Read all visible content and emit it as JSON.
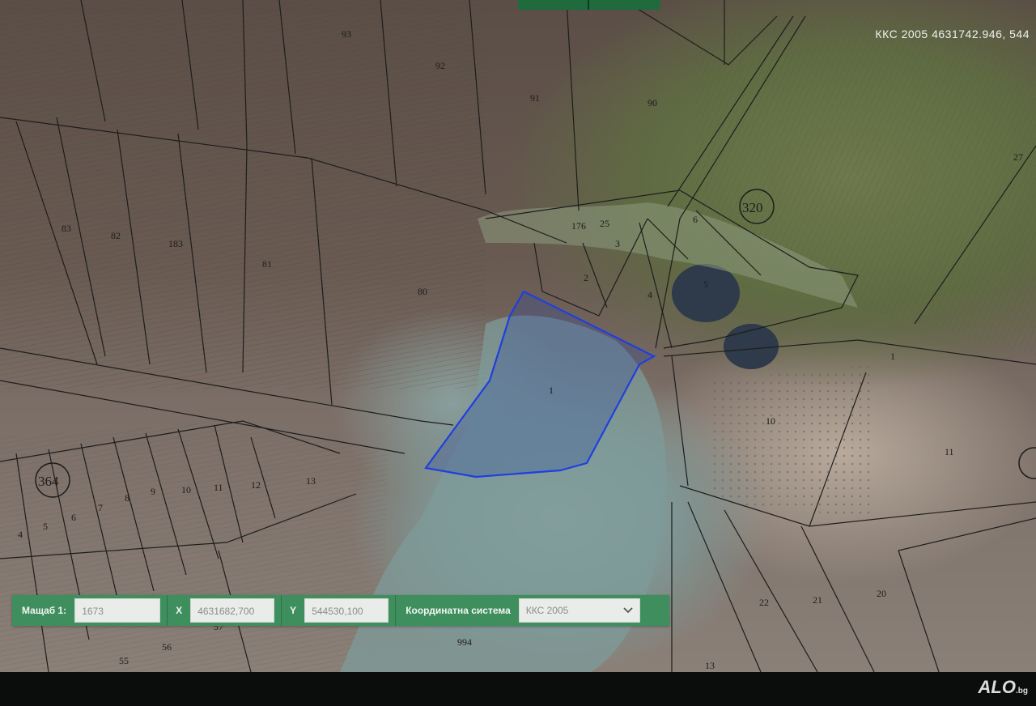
{
  "coordinate_readout": "ККС 2005 4631742.946, 544",
  "parcels": {
    "n93": "93",
    "n92": "92",
    "n91": "91",
    "n90": "90",
    "n83": "83",
    "n82": "82",
    "n183": "183",
    "n81": "81",
    "n80": "80",
    "n176": "176",
    "n25": "25",
    "n3": "3",
    "n6": "6",
    "n2": "2",
    "n4": "4",
    "n5": "5",
    "n1_lake": "1",
    "n1_right": "1",
    "n10": "10",
    "n11": "11",
    "n27": "27",
    "block_320": "320",
    "block_364": "364",
    "s4": "4",
    "s5": "5",
    "s6": "6",
    "s7": "7",
    "s8": "8",
    "s9": "9",
    "s10": "10",
    "s11": "11",
    "s12": "12",
    "s13": "13",
    "n56": "56",
    "n57": "57",
    "n55": "55",
    "n994": "994",
    "n22": "22",
    "n21": "21",
    "n20": "20",
    "n13": "13"
  },
  "selected_polygon_color": "#1f3fe0",
  "toolbar": {
    "scale_label": "Мащаб  1:",
    "scale_value": "1673",
    "x_label": "X",
    "x_value": "4631682,700",
    "y_label": "Y",
    "y_value": "544530,100",
    "crs_label": "Координатна система",
    "crs_value": "ККС 2005",
    "crs_icon": "chevron-down-icon"
  },
  "watermark": {
    "main": "ALO",
    "suffix": ".bg"
  }
}
